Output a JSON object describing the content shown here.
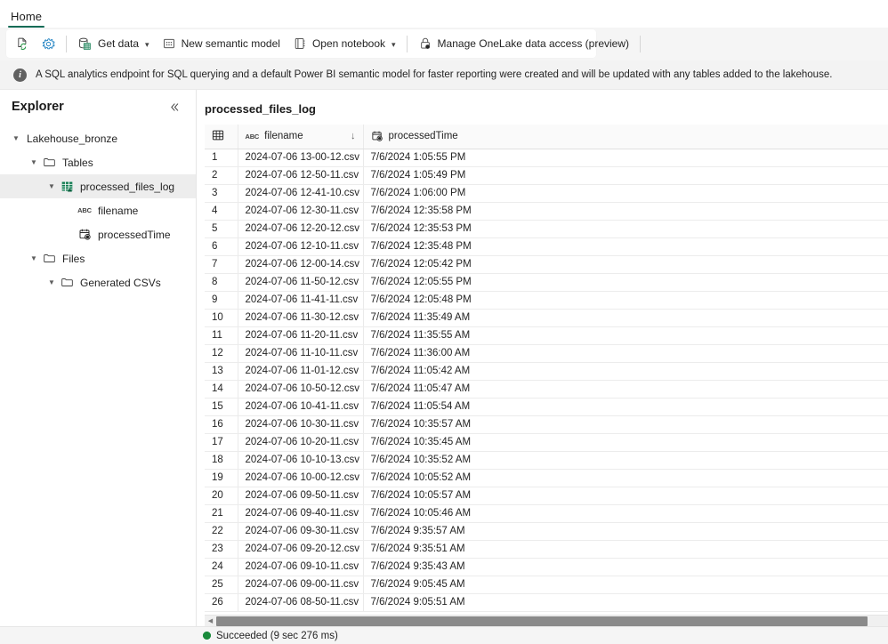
{
  "ribbon": {
    "tabs": [
      {
        "label": "Home",
        "active": true
      }
    ]
  },
  "toolbar": {
    "refresh_label": "Refresh",
    "settings_label": "Settings",
    "get_data_label": "Get data",
    "new_semantic_model_label": "New semantic model",
    "open_notebook_label": "Open notebook",
    "manage_onelake_label": "Manage OneLake data access (preview)",
    "chevron": "⌄"
  },
  "info_bar": {
    "icon": "info-icon",
    "message": "A SQL analytics endpoint for SQL querying and a default Power BI semantic model for faster reporting were created and will be updated with any tables added to the lakehouse."
  },
  "explorer": {
    "title": "Explorer",
    "collapse_icon": "«",
    "tree": [
      {
        "label": "Lakehouse_bronze",
        "indent": 0,
        "icon": "none",
        "expanded": true,
        "selected": false
      },
      {
        "label": "Tables",
        "indent": 1,
        "icon": "folder",
        "expanded": true,
        "selected": false
      },
      {
        "label": "processed_files_log",
        "indent": 2,
        "icon": "table",
        "expanded": true,
        "selected": true
      },
      {
        "label": "filename",
        "indent": 3,
        "icon": "abc",
        "expanded": null,
        "selected": false
      },
      {
        "label": "processedTime",
        "indent": 3,
        "icon": "datetime",
        "expanded": null,
        "selected": false
      },
      {
        "label": "Files",
        "indent": 1,
        "icon": "folder",
        "expanded": true,
        "selected": false
      },
      {
        "label": "Generated CSVs",
        "indent": 2,
        "icon": "folder",
        "expanded": true,
        "selected": false
      }
    ]
  },
  "main": {
    "table_title": "processed_files_log",
    "columns": [
      {
        "key": "idx",
        "label": "",
        "icon": "grid-icon",
        "sort": ""
      },
      {
        "key": "filename",
        "label": "filename",
        "icon": "abc-icon",
        "sort": "↓"
      },
      {
        "key": "processedTime",
        "label": "processedTime",
        "icon": "datetime-icon",
        "sort": ""
      }
    ],
    "rows": [
      {
        "idx": "1",
        "filename": "2024-07-06 13-00-12.csv",
        "processedTime": "7/6/2024 1:05:55 PM"
      },
      {
        "idx": "2",
        "filename": "2024-07-06 12-50-11.csv",
        "processedTime": "7/6/2024 1:05:49 PM"
      },
      {
        "idx": "3",
        "filename": "2024-07-06 12-41-10.csv",
        "processedTime": "7/6/2024 1:06:00 PM"
      },
      {
        "idx": "4",
        "filename": "2024-07-06 12-30-11.csv",
        "processedTime": "7/6/2024 12:35:58 PM"
      },
      {
        "idx": "5",
        "filename": "2024-07-06 12-20-12.csv",
        "processedTime": "7/6/2024 12:35:53 PM"
      },
      {
        "idx": "6",
        "filename": "2024-07-06 12-10-11.csv",
        "processedTime": "7/6/2024 12:35:48 PM"
      },
      {
        "idx": "7",
        "filename": "2024-07-06 12-00-14.csv",
        "processedTime": "7/6/2024 12:05:42 PM"
      },
      {
        "idx": "8",
        "filename": "2024-07-06 11-50-12.csv",
        "processedTime": "7/6/2024 12:05:55 PM"
      },
      {
        "idx": "9",
        "filename": "2024-07-06 11-41-11.csv",
        "processedTime": "7/6/2024 12:05:48 PM"
      },
      {
        "idx": "10",
        "filename": "2024-07-06 11-30-12.csv",
        "processedTime": "7/6/2024 11:35:49 AM"
      },
      {
        "idx": "11",
        "filename": "2024-07-06 11-20-11.csv",
        "processedTime": "7/6/2024 11:35:55 AM"
      },
      {
        "idx": "12",
        "filename": "2024-07-06 11-10-11.csv",
        "processedTime": "7/6/2024 11:36:00 AM"
      },
      {
        "idx": "13",
        "filename": "2024-07-06 11-01-12.csv",
        "processedTime": "7/6/2024 11:05:42 AM"
      },
      {
        "idx": "14",
        "filename": "2024-07-06 10-50-12.csv",
        "processedTime": "7/6/2024 11:05:47 AM"
      },
      {
        "idx": "15",
        "filename": "2024-07-06 10-41-11.csv",
        "processedTime": "7/6/2024 11:05:54 AM"
      },
      {
        "idx": "16",
        "filename": "2024-07-06 10-30-11.csv",
        "processedTime": "7/6/2024 10:35:57 AM"
      },
      {
        "idx": "17",
        "filename": "2024-07-06 10-20-11.csv",
        "processedTime": "7/6/2024 10:35:45 AM"
      },
      {
        "idx": "18",
        "filename": "2024-07-06 10-10-13.csv",
        "processedTime": "7/6/2024 10:35:52 AM"
      },
      {
        "idx": "19",
        "filename": "2024-07-06 10-00-12.csv",
        "processedTime": "7/6/2024 10:05:52 AM"
      },
      {
        "idx": "20",
        "filename": "2024-07-06 09-50-11.csv",
        "processedTime": "7/6/2024 10:05:57 AM"
      },
      {
        "idx": "21",
        "filename": "2024-07-06 09-40-11.csv",
        "processedTime": "7/6/2024 10:05:46 AM"
      },
      {
        "idx": "22",
        "filename": "2024-07-06 09-30-11.csv",
        "processedTime": "7/6/2024 9:35:57 AM"
      },
      {
        "idx": "23",
        "filename": "2024-07-06 09-20-12.csv",
        "processedTime": "7/6/2024 9:35:51 AM"
      },
      {
        "idx": "24",
        "filename": "2024-07-06 09-10-11.csv",
        "processedTime": "7/6/2024 9:35:43 AM"
      },
      {
        "idx": "25",
        "filename": "2024-07-06 09-00-11.csv",
        "processedTime": "7/6/2024 9:05:45 AM"
      },
      {
        "idx": "26",
        "filename": "2024-07-06 08-50-11.csv",
        "processedTime": "7/6/2024 9:05:51 AM"
      }
    ]
  },
  "status_bar": {
    "state": "Succeeded",
    "text": "Succeeded (9 sec 276 ms)"
  },
  "colors": {
    "accent_green": "#0f6b56",
    "success_green": "#1a8b3c",
    "table_icon_green": "#107c51",
    "gear_blue": "#1a7fc1",
    "info_gray": "#616161"
  }
}
